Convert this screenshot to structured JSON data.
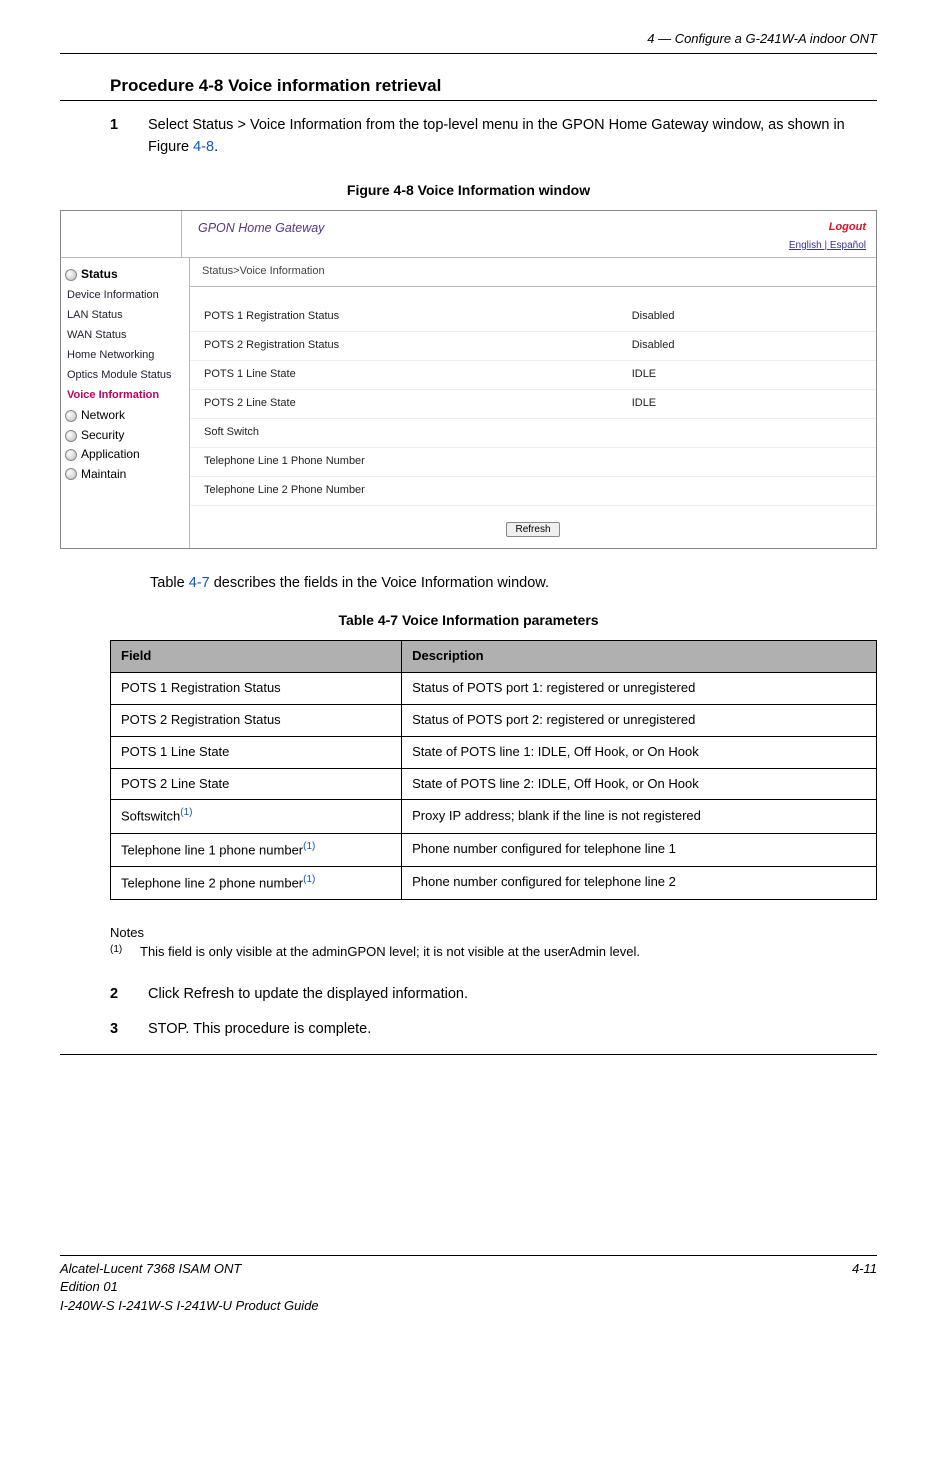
{
  "chapterHeader": "4 —  Configure a G-241W-A indoor ONT",
  "procedureTitle": "Procedure 4-8  Voice information retrieval",
  "steps": {
    "s1num": "1",
    "s1a": "Select Status > Voice Information from the top-level menu in the GPON Home Gateway window, as shown in Figure ",
    "s1link": "4-8",
    "s1b": ".",
    "s2num": "2",
    "s2": "Click Refresh to update the displayed information.",
    "s3num": "3",
    "s3": "STOP. This procedure is complete."
  },
  "figureCaption": "Figure 4-8  Voice Information window",
  "bodyLead": "Table ",
  "bodyLink": "4-7",
  "bodyTail": " describes the fields in the Voice Information window.",
  "tableCaption": "Table 4-7 Voice Information parameters",
  "screenshot": {
    "bannerTitle": "GPON Home Gateway",
    "logout": "Logout",
    "langEnglish": "English",
    "langSep": " | ",
    "langSpanish": "Español",
    "crumb": "Status>Voice Information",
    "side": {
      "status": "Status",
      "devinfo": "Device Information",
      "lan": "LAN Status",
      "wan": "WAN Status",
      "home": "Home Networking",
      "optics": "Optics Module Status",
      "voice": "Voice Information",
      "network": "Network",
      "security": "Security",
      "application": "Application",
      "maintain": "Maintain"
    },
    "rows": {
      "r1k": "POTS 1 Registration Status",
      "r1v": "Disabled",
      "r2k": "POTS 2 Registration Status",
      "r2v": "Disabled",
      "r3k": "POTS 1 Line State",
      "r3v": "IDLE",
      "r4k": "POTS 2 Line State",
      "r4v": "IDLE",
      "r5k": "Soft Switch",
      "r5v": "",
      "r6k": "Telephone Line 1 Phone Number",
      "r6v": "",
      "r7k": "Telephone Line 2 Phone Number",
      "r7v": ""
    },
    "refresh": "Refresh"
  },
  "table": {
    "h1": "Field",
    "h2": "Description",
    "r1f": "POTS 1 Registration Status",
    "r1d": "Status of POTS port 1: registered or unregistered",
    "r2f": "POTS 2 Registration Status",
    "r2d": "Status of POTS port 2: registered or unregistered",
    "r3f": "POTS 1 Line State",
    "r3d": "State of POTS line 1: IDLE, Off Hook, or On Hook",
    "r4f": "POTS 2 Line State",
    "r4d": "State of POTS line 2: IDLE, Off Hook, or On Hook",
    "r5fa": "Softswitch",
    "r5d": "Proxy IP address; blank if the line is not registered",
    "r6fa": "Telephone line 1 phone number",
    "r6d": "Phone number configured for telephone line 1",
    "r7fa": "Telephone line 2 phone number",
    "r7d": "Phone number configured for telephone line 2",
    "noteSup": "(1)"
  },
  "notes": {
    "hdr": "Notes",
    "marker": "(1)",
    "text": "This field is only visible at the adminGPON level; it is not visible at the userAdmin level."
  },
  "footer": {
    "left1": "Alcatel-Lucent 7368 ISAM ONT",
    "left2": "Edition 01",
    "left3": "I-240W-S I-241W-S I-241W-U Product Guide",
    "right": "4-11"
  }
}
